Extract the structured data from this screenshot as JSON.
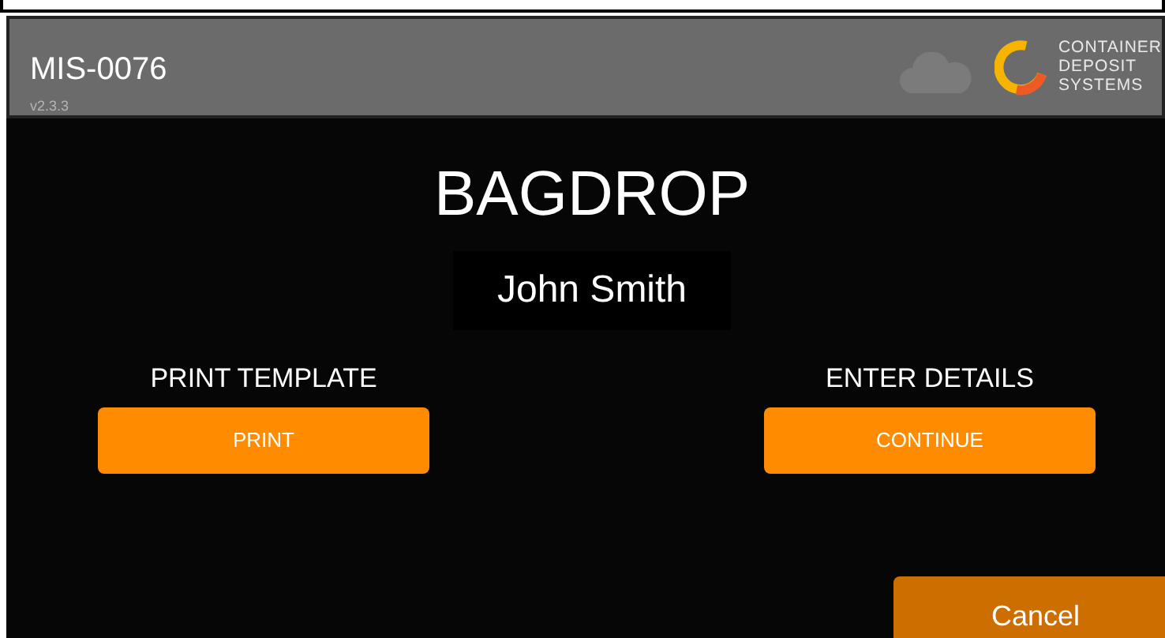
{
  "header": {
    "title": "MIS-0076",
    "version": "v2.3.3",
    "logo_lines": [
      "CONTAINER",
      "DEPOSIT",
      "SYSTEMS"
    ]
  },
  "screen": {
    "title": "BAGDROP",
    "name": "John Smith"
  },
  "actions": [
    {
      "label": "PRINT TEMPLATE",
      "button": "PRINT"
    },
    {
      "label": "ENTER DETAILS",
      "button": "CONTINUE"
    }
  ],
  "cancel": "Cancel"
}
